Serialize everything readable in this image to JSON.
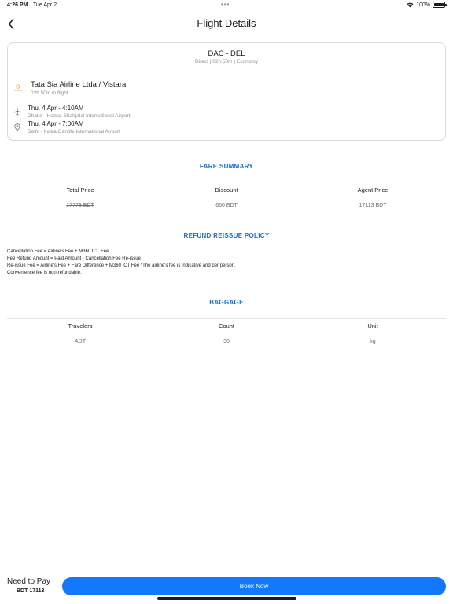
{
  "status": {
    "time": "4:26 PM",
    "date": "Tue Apr 2",
    "dots": "•••",
    "battery": "100%"
  },
  "header": {
    "title": "Flight Details"
  },
  "flight": {
    "route": "DAC - DEL",
    "subtitle": "Direct | 02h 50m | Economy",
    "airline": "Tata Sia Airline Ltda / Vistara",
    "duration": "02h 50m in flight",
    "departure": {
      "time": "Thu, 4 Apr - 4:10AM",
      "airport": "Dhaka - Hazrat Shahjalal International Airport"
    },
    "arrival": {
      "time": "Thu, 4 Apr - 7:00AM",
      "airport": "Delhi - Indira Gandhi International Airport"
    }
  },
  "fare": {
    "title": "FARE SUMMARY",
    "headers": [
      "Total Price",
      "Discount",
      "Agent Price"
    ],
    "row": [
      "17773 BDT",
      "660 BDT",
      "17113 BDT"
    ]
  },
  "refund": {
    "title": "REFUND REISSUE POLICY",
    "lines": [
      "Cancellation Fee = Airline's Fee + M360 ICT Fee",
      "Fee Refund Amount = Paid Amount - Cancellation Fee Re-issue",
      "Re-issue Fee = Airline's Fee + Fare Difference + M360 ICT Fee *The airline's fee is indicative and per person.",
      "Convenience fee is non-refundable."
    ]
  },
  "baggage": {
    "title": "BAGGAGE",
    "headers": [
      "Travelers",
      "Count",
      "Unit"
    ],
    "row": [
      "ADT",
      "30",
      "kg"
    ]
  },
  "footer": {
    "need_label": "Need to Pay",
    "amount": "BDT 17113",
    "book_label": "Book Now"
  },
  "colors": {
    "accent": "#1a6fd1",
    "button": "#1377ff",
    "muted": "#8e8e93"
  }
}
